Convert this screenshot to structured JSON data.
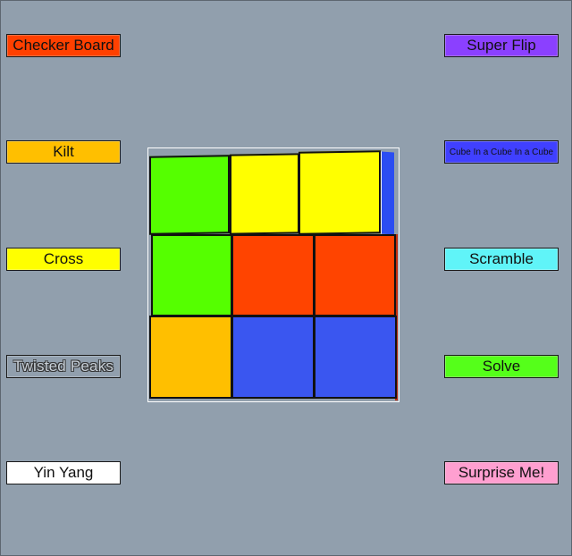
{
  "buttons": {
    "checker_board": "Checker Board",
    "kilt": "Kilt",
    "cross": "Cross",
    "twisted_peaks": "Twisted Peaks",
    "yin_yang": "Yin Yang",
    "super_flip": "Super Flip",
    "cube_in_a_cube": "Cube In a Cube In a Cube",
    "scramble": "Scramble",
    "solve": "Solve",
    "surprise_me": "Surprise Me!"
  },
  "colors": {
    "background": "#919fad",
    "checker_board": "#ff4000",
    "kilt": "#ffbf00",
    "cross": "#ffff00",
    "twisted_peaks": "#919fad",
    "yin_yang": "#ffffff",
    "super_flip": "#8b40ff",
    "cube_in_a_cube": "#4040ff",
    "scramble": "#60f4f8",
    "solve": "#55ff1a",
    "surprise_me": "#ff9fd0",
    "green": "#55ff00",
    "yellow": "#ffff00",
    "red": "#ff4400",
    "orange": "#ffbf00",
    "blue": "#3a56f0"
  },
  "cube_face": [
    [
      "green",
      "yellow",
      "yellow"
    ],
    [
      "green",
      "red",
      "red"
    ],
    [
      "orange",
      "blue",
      "blue"
    ]
  ]
}
